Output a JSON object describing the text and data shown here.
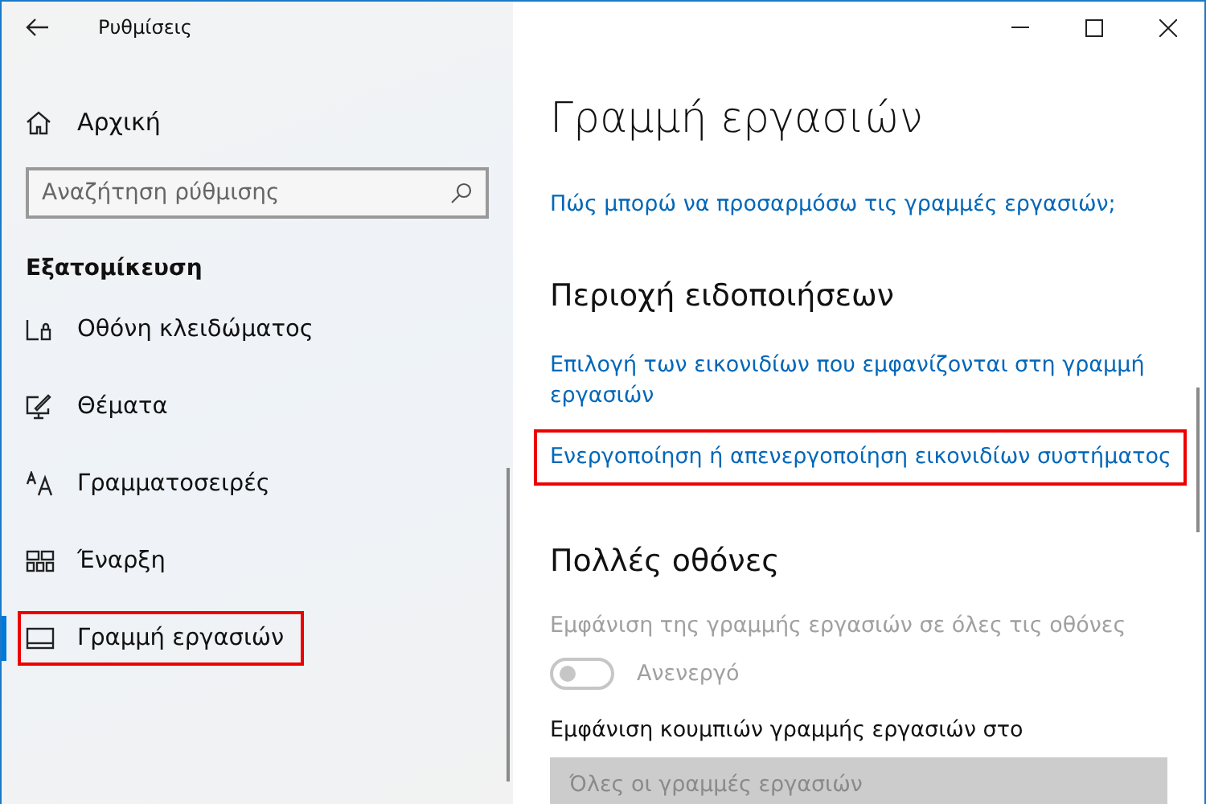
{
  "window": {
    "title": "Ρυθμίσεις"
  },
  "sidebar": {
    "home": "Αρχική",
    "search": {
      "placeholder": "Αναζήτηση ρύθμισης"
    },
    "section": "Εξατομίκευση",
    "items": [
      {
        "label": "Οθόνη κλειδώματος",
        "kind": "lock",
        "selected": false,
        "highlighted": false
      },
      {
        "label": "Θέματα",
        "kind": "themes",
        "selected": false,
        "highlighted": false
      },
      {
        "label": "Γραμματοσειρές",
        "kind": "fonts",
        "selected": false,
        "highlighted": false
      },
      {
        "label": "Έναρξη",
        "kind": "start",
        "selected": false,
        "highlighted": false
      },
      {
        "label": "Γραμμή εργασιών",
        "kind": "taskbar",
        "selected": true,
        "highlighted": true
      }
    ]
  },
  "content": {
    "title": "Γραμμή εργασιών",
    "items": [
      {
        "kind": "link",
        "text": "Πώς μπορώ να προσαρμόσω τις γραμμές εργασιών;",
        "highlighted": false
      },
      {
        "kind": "heading",
        "text": "Περιοχή ειδοποιήσεων"
      },
      {
        "kind": "link",
        "text": "Επιλογή των εικονιδίων που εμφανίζονται στη γραμμή εργασιών",
        "highlighted": false
      },
      {
        "kind": "link",
        "text": "Ενεργοποίηση ή απενεργοποίηση εικονιδίων συστήματος",
        "highlighted": true
      },
      {
        "kind": "heading",
        "text": "Πολλές οθόνες"
      },
      {
        "kind": "label",
        "text": "Εμφάνιση της γραμμής εργασιών σε όλες τις οθόνες",
        "disabled": true
      },
      {
        "kind": "toggle",
        "on": false,
        "disabled": true,
        "state_text": "Ανενεργό"
      },
      {
        "kind": "label",
        "text": "Εμφάνιση κουμπιών γραμμής εργασιών στο",
        "disabled": false
      },
      {
        "kind": "dropdown",
        "value": "Όλες οι γραμμές εργασιών",
        "disabled": true
      }
    ]
  }
}
